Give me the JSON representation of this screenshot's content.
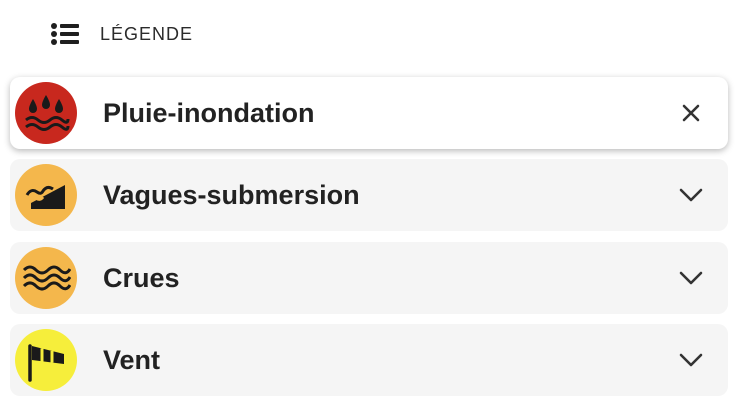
{
  "header": {
    "icon": "list-icon",
    "title": "LÉGENDE"
  },
  "items": [
    {
      "label": "Pluie-inondation",
      "icon": "rain-flood-icon",
      "color": "#c8281e",
      "state": "expanded",
      "action_icon": "close-icon"
    },
    {
      "label": "Vagues-submersion",
      "icon": "waves-submersion-icon",
      "color": "#f4b74c",
      "state": "collapsed",
      "action_icon": "chevron-down-icon"
    },
    {
      "label": "Crues",
      "icon": "floods-icon",
      "color": "#f4b74c",
      "state": "collapsed",
      "action_icon": "chevron-down-icon"
    },
    {
      "label": "Vent",
      "icon": "windsock-icon",
      "color": "#f6ee3b",
      "state": "collapsed",
      "action_icon": "chevron-down-icon"
    }
  ]
}
